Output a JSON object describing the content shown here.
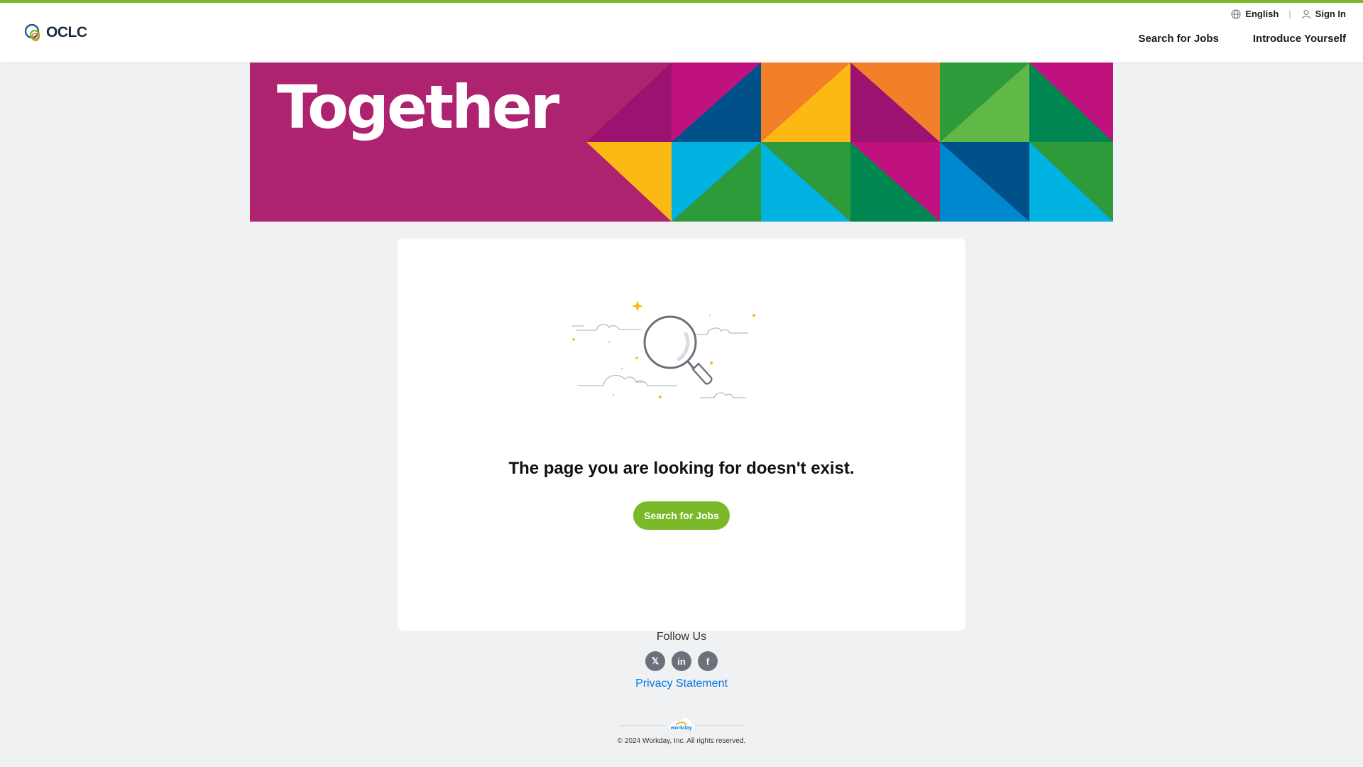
{
  "header": {
    "logo_text": "OCLC",
    "language_label": "English",
    "sign_in_label": "Sign In",
    "nav": [
      "Search for Jobs",
      "Introduce Yourself"
    ]
  },
  "banner": {
    "title": "Together"
  },
  "error_card": {
    "message": "The page you are looking for doesn't exist.",
    "button_label": "Search for Jobs"
  },
  "footer": {
    "follow_label": "Follow Us",
    "social": [
      {
        "name": "x-icon",
        "glyph": "𝕏"
      },
      {
        "name": "linkedin-icon",
        "glyph": "in"
      },
      {
        "name": "facebook-icon",
        "glyph": "f"
      }
    ],
    "privacy_label": "Privacy Statement",
    "workday_logo_text": "workday",
    "copyright": "© 2024 Workday, Inc. All rights reserved."
  },
  "colors": {
    "accent_green": "#7ab929",
    "banner_magenta": "#ad236f",
    "link_blue": "#0875e1",
    "page_bg": "#f0f1f3"
  }
}
